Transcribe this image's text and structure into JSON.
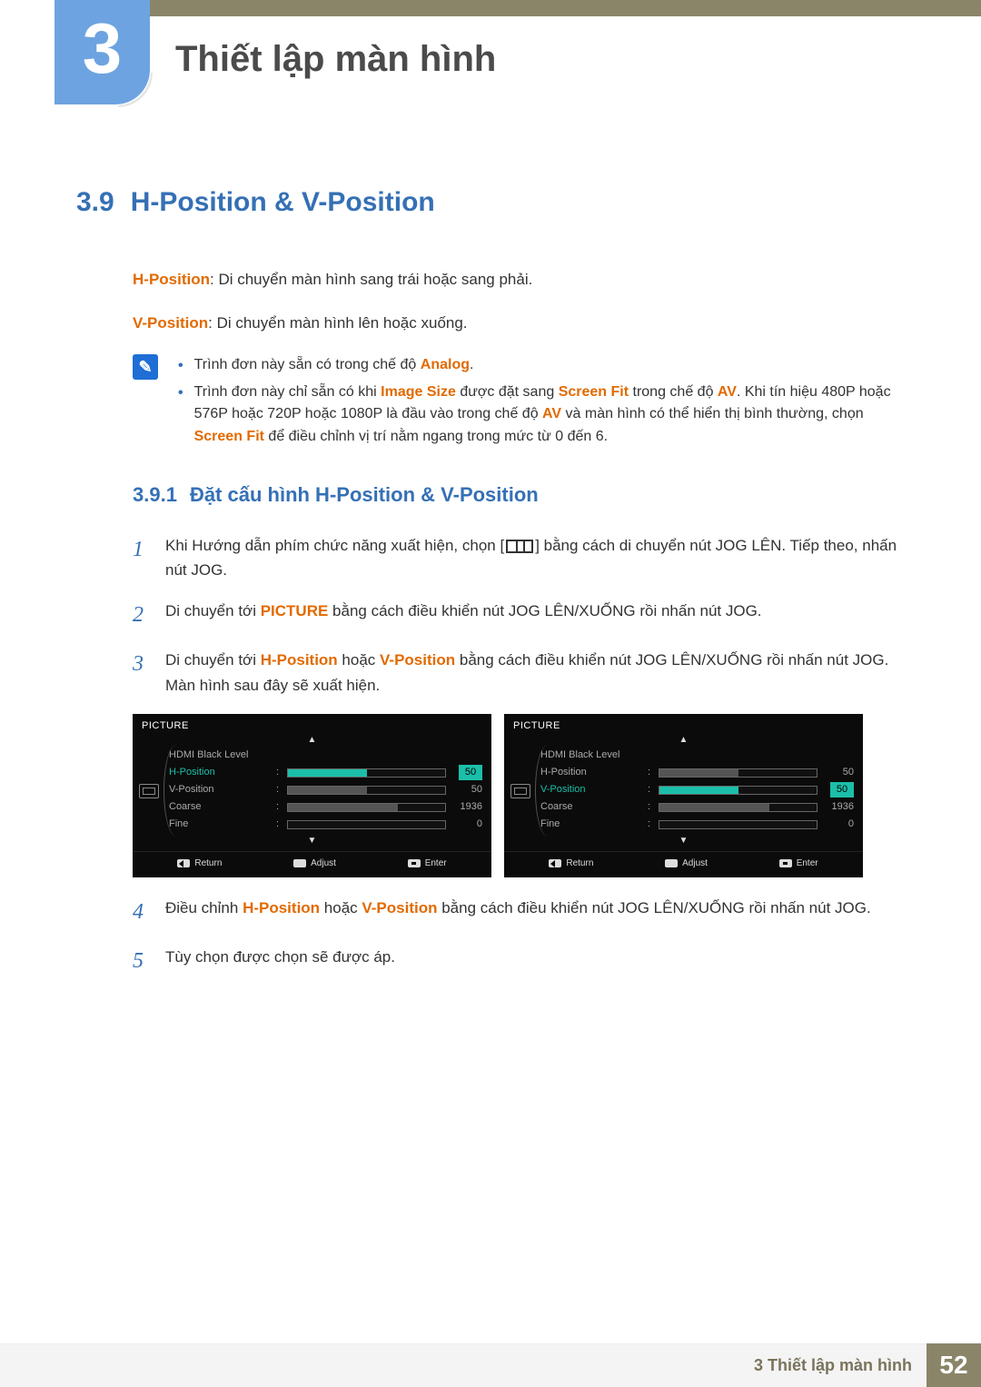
{
  "chapter": {
    "number": "3",
    "title": "Thiết lập màn hình"
  },
  "section": {
    "number": "3.9",
    "title": "H-Position & V-Position"
  },
  "definitions": {
    "h_label": "H-Position",
    "h_text": ": Di chuyển màn hình sang trái hoặc sang phải.",
    "v_label": "V-Position",
    "v_text": ": Di chuyển màn hình lên hoặc xuống."
  },
  "notes": {
    "n1_a": "Trình đơn này sẵn có trong chế độ ",
    "n1_b": "Analog",
    "n1_c": ".",
    "n2_a": "Trình đơn này chỉ sẵn có khi ",
    "n2_b": "Image Size",
    "n2_c": " được đặt sang ",
    "n2_d": "Screen Fit",
    "n2_e": " trong chế độ ",
    "n2_f": "AV",
    "n2_g": ". Khi tín hiệu 480P hoặc 576P hoặc 720P hoặc 1080P là đầu vào trong chế độ ",
    "n2_h": "AV",
    "n2_i": " và màn hình có thể hiển thị bình thường, chọn ",
    "n2_j": "Screen Fit",
    "n2_k": " để điều chỉnh vị trí nằm ngang trong mức từ 0 đến 6."
  },
  "subsection": {
    "number": "3.9.1",
    "title": "Đặt cấu hình H-Position & V-Position"
  },
  "steps": {
    "s1a": "Khi Hướng dẫn phím chức năng xuất hiện, chọn [",
    "s1b": "] bằng cách di chuyển nút JOG LÊN. Tiếp theo, nhấn nút JOG.",
    "s2a": "Di chuyển tới ",
    "s2b": "PICTURE",
    "s2c": " bằng cách điều khiển nút JOG LÊN/XUỐNG rồi nhấn nút JOG.",
    "s3a": "Di chuyển tới ",
    "s3b": "H-Position",
    "s3c": " hoặc ",
    "s3d": "V-Position",
    "s3e": " bằng cách điều khiển nút JOG LÊN/XUỐNG rồi nhấn nút JOG. Màn hình sau đây sẽ xuất hiện.",
    "s4a": "Điều chỉnh ",
    "s4b": "H-Position",
    "s4c": " hoặc ",
    "s4d": "V-Position",
    "s4e": " bằng cách điều khiển nút JOG LÊN/XUỐNG rồi nhấn nút JOG.",
    "s5": "Tùy chọn được chọn sẽ được áp."
  },
  "osd": {
    "title": "PICTURE",
    "rows": {
      "hdmi": "HDMI Black Level",
      "hpos": "H-Position",
      "vpos": "V-Position",
      "coarse": "Coarse",
      "fine": "Fine"
    },
    "vals": {
      "hpos": "50",
      "vpos": "50",
      "coarse": "1936",
      "fine": "0"
    },
    "footer": {
      "return": "Return",
      "adjust": "Adjust",
      "enter": "Enter"
    }
  },
  "footer": {
    "label": "3 Thiết lập màn hình",
    "page": "52"
  }
}
